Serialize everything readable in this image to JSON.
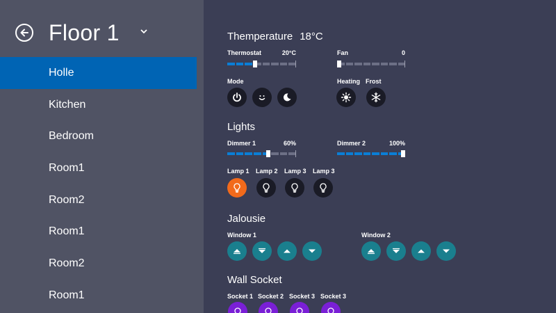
{
  "sidebar": {
    "title": "Floor 1",
    "items": [
      "Holle",
      "Kitchen",
      "Bedroom",
      "Room1",
      "Room2",
      "Room1",
      "Room2",
      "Room1"
    ]
  },
  "temperature": {
    "title": "Themperature",
    "value": "18°C",
    "thermostat": {
      "label": "Thermostat",
      "value": "20°C",
      "level": 0.4
    },
    "fan": {
      "label": "Fan",
      "value": "0",
      "level": 0
    },
    "mode_label": "Mode",
    "heating_label": "Heating",
    "frost_label": "Frost"
  },
  "lights": {
    "title": "Lights",
    "dimmer1": {
      "label": "Dimmer 1",
      "value": "60%",
      "level": 0.6
    },
    "dimmer2": {
      "label": "Dimmer 2",
      "value": "100%",
      "level": 1.0
    },
    "lamps": [
      "Lamp 1",
      "Lamp 2",
      "Lamp 3",
      "Lamp 3"
    ]
  },
  "jalousie": {
    "title": "Jalousie",
    "window1": "Window 1",
    "window2": "Window 2"
  },
  "wall_socket": {
    "title": "Wall Socket",
    "sockets": [
      "Socket 1",
      "Socket 2",
      "Socket 3",
      "Socket 3"
    ]
  },
  "colors": {
    "accent": "#0064b4",
    "lamp_on": "#f26a1b",
    "jalousie": "#1a7f8e",
    "socket": "#7a1fd6"
  }
}
